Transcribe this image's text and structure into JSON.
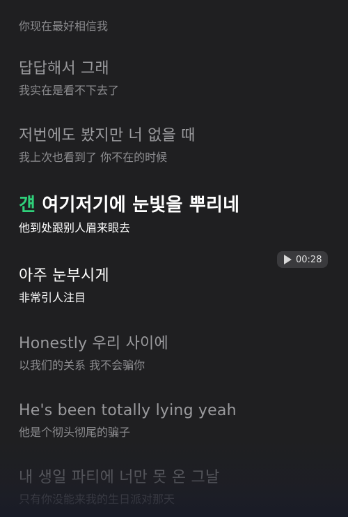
{
  "player": {
    "time_chip": "00:28",
    "play_icon": "play-icon"
  },
  "lyrics": [
    {
      "sub": "你现在最好相信我"
    },
    {
      "main": "답답해서 그래",
      "sub": "我实在是看不下去了"
    },
    {
      "main": "저번에도 봤지만 너 없을 때",
      "sub": "我上次也看到了 你不在的时候"
    },
    {
      "main_highlight": "걘",
      "main_rest": " 여기저기에 눈빛을 뿌리네",
      "sub": "他到处跟别人眉来眼去"
    },
    {
      "main": "아주 눈부시게",
      "sub": "非常引人注目"
    },
    {
      "main": "Honestly 우리 사이에",
      "sub": "以我们的关系 我不会骗你"
    },
    {
      "main": "He's been totally lying yeah",
      "sub": "他是个彻头彻尾的骗子"
    },
    {
      "main": "내 생일 파티에 너만 못 온 그날",
      "sub": "只有你没能来我的生日派对那天"
    }
  ],
  "colors": {
    "background": "#1f1f21",
    "highlight": "#2fd07a",
    "active_text": "#ffffff",
    "inactive_text": "#9a9a9d"
  }
}
